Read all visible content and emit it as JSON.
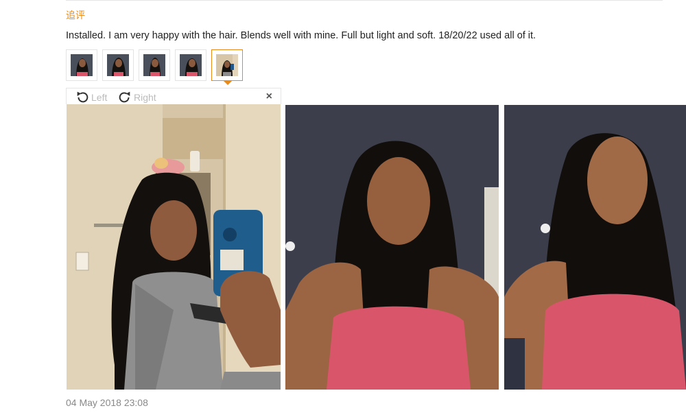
{
  "review": {
    "followup_label": "追评",
    "text": "Installed. I am very happy with the hair. Blends well with mine. Full but light and soft. 18/20/22 used all of it.",
    "date": "04 May 2018 23:08"
  },
  "thumbnails": [
    {
      "icon": "review-photo-1",
      "active": false
    },
    {
      "icon": "review-photo-2",
      "active": false
    },
    {
      "icon": "review-photo-3",
      "active": false
    },
    {
      "icon": "review-photo-4",
      "active": false
    },
    {
      "icon": "review-photo-5",
      "active": true
    }
  ],
  "viewer": {
    "rotate_left_label": "Left",
    "rotate_right_label": "Right",
    "close_symbol": "×"
  },
  "colors": {
    "accent": "#e88b1a",
    "wall_dark": "#3b3e4a",
    "top_pink": "#d9566a"
  }
}
